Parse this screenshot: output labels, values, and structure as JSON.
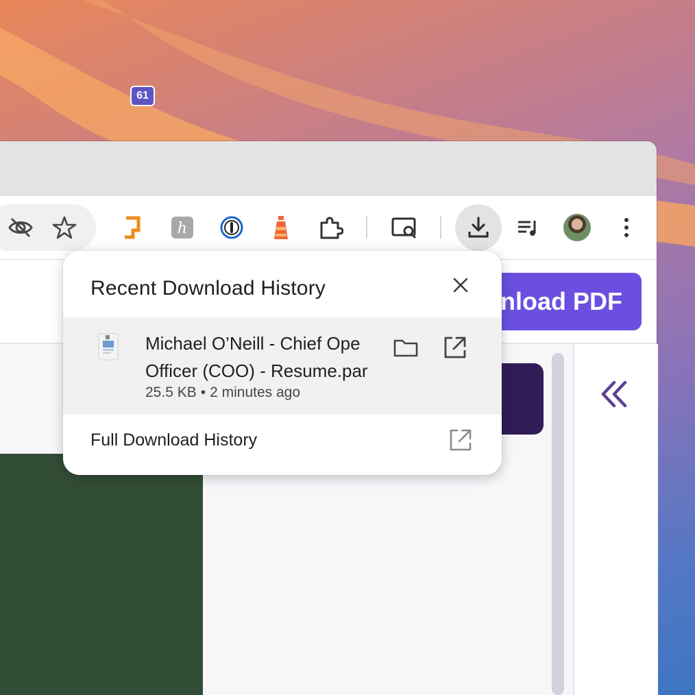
{
  "toolbar": {
    "extensions_badge_count": "61",
    "icons": [
      "eye-off-icon",
      "star-icon",
      "extension-orange-icon",
      "honey-icon",
      "password-manager-icon",
      "lighthouse-icon",
      "puzzle-icon",
      "screen-search-icon",
      "download-icon",
      "media-control-icon",
      "profile-avatar",
      "more-vert-icon"
    ]
  },
  "page": {
    "download_pdf_label": "nload PDF"
  },
  "downloads": {
    "title": "Recent Download History",
    "item": {
      "name": "Michael O’Neill - Chief Operating Officer (COO) - Resume.pdf",
      "name_line1": "Michael O’Neill - Chief Ope",
      "name_line2": "Officer (COO) - Resume.par",
      "size": "25.5 KB",
      "separator": "•",
      "time": "2 minutes ago"
    },
    "full_history_label": "Full Download History"
  },
  "colors": {
    "accent_purple": "#6a4fe0",
    "dark_purple": "#311c57",
    "green_block": "#324d36",
    "badge": "#5c55c4"
  }
}
